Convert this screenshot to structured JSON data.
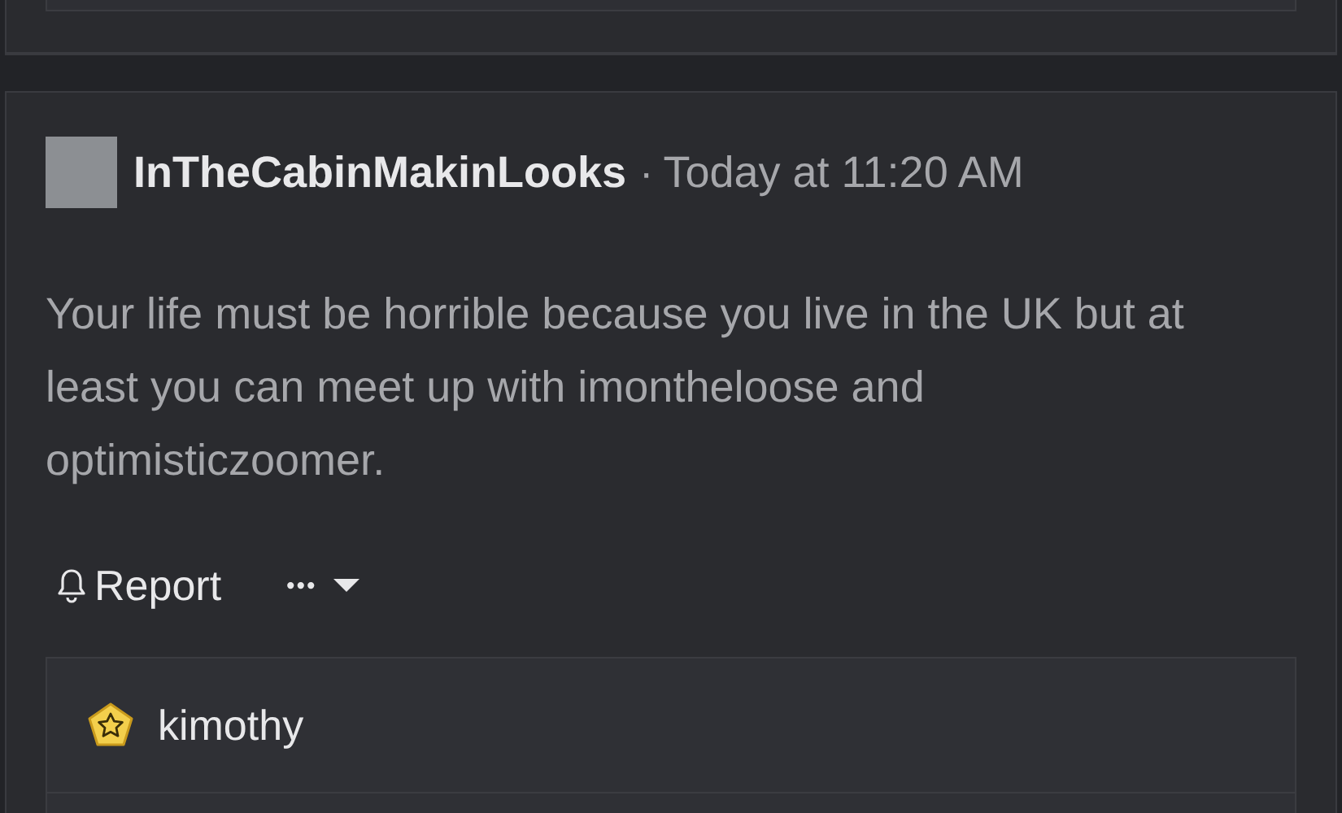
{
  "post": {
    "author": "InTheCabinMakinLooks",
    "separator": "·",
    "time": "Today at 11:20 AM",
    "body": "Your life must be horrible because you live in the UK but at least you can meet up with imontheloose and optimisticzoomer.",
    "actions": [
      {
        "kind": "report",
        "label": "Report"
      },
      {
        "kind": "more",
        "label": "•••"
      }
    ]
  },
  "reactions": [
    {
      "user": "kimothy"
    }
  ]
}
